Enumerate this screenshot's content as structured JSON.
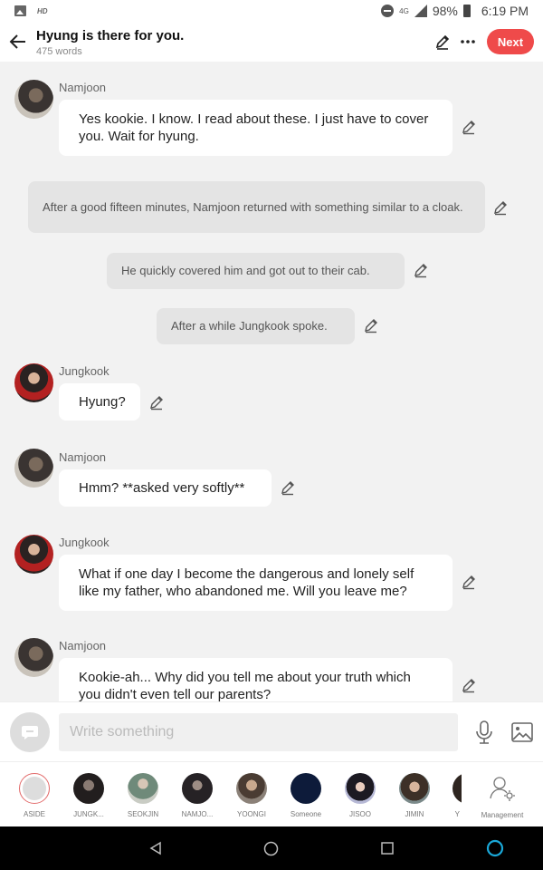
{
  "status_bar": {
    "hd": "HD",
    "network": "4G",
    "battery": "98%",
    "time": "6:19 PM"
  },
  "header": {
    "title": "Hyung is there for you.",
    "word_count": "475 words",
    "next_label": "Next"
  },
  "messages": [
    {
      "type": "dialogue",
      "speaker": "Namjoon",
      "text": "Yes kookie. I know. I read about these. I just have to cover you. Wait for hyung."
    },
    {
      "type": "narration",
      "text": "After a good fifteen minutes, Namjoon returned with something similar to a cloak."
    },
    {
      "type": "narration",
      "text": "He quickly covered him and got out to their cab."
    },
    {
      "type": "narration",
      "text": "After a while Jungkook spoke."
    },
    {
      "type": "dialogue",
      "speaker": "Jungkook",
      "text": "Hyung?"
    },
    {
      "type": "dialogue",
      "speaker": "Namjoon",
      "text": "Hmm? **asked very softly**"
    },
    {
      "type": "dialogue",
      "speaker": "Jungkook",
      "text": "What if one day I become the dangerous and lonely self like my father, who abandoned me. Will you leave me?"
    },
    {
      "type": "dialogue",
      "speaker": "Namjoon",
      "text": "Kookie-ah... Why did you tell me about your truth which you didn't even tell our parents?"
    }
  ],
  "composer": {
    "placeholder": "Write something"
  },
  "characters": [
    {
      "label": "ASIDE"
    },
    {
      "label": "JUNGK..."
    },
    {
      "label": "SEOKJIN"
    },
    {
      "label": "NAMJO..."
    },
    {
      "label": "YOONGI"
    },
    {
      "label": "Someone"
    },
    {
      "label": "JISOO"
    },
    {
      "label": "JIMIN"
    },
    {
      "label": "Y"
    },
    {
      "label": "Management"
    }
  ],
  "colors": {
    "accent": "#ef4a4a",
    "background": "#f2f2f2",
    "bubble": "#ffffff",
    "narration": "#e4e4e4"
  }
}
